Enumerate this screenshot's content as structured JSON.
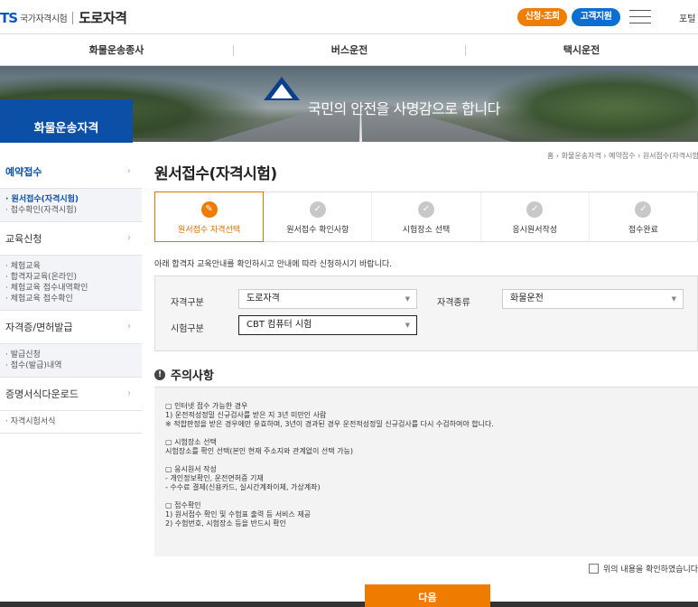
{
  "header": {
    "logo_ts": "TS",
    "logo_org": "국가자격시험",
    "logo_site": "도로자격",
    "apply_label": "신청·조회",
    "support_label": "고객지원",
    "portal_label": "포털"
  },
  "topnav": [
    "화물운송종사",
    "버스운전",
    "택시운전"
  ],
  "banner": {
    "slogan": "국민의 안전을 사명감으로 합니다",
    "side_title": "화물운송자격"
  },
  "sidebar": [
    {
      "label": "예약접수",
      "active": true,
      "subs": [
        {
          "label": "· 원서접수(자격시험)",
          "on": true
        },
        {
          "label": "· 접수확인(자격시험)",
          "on": false
        }
      ]
    },
    {
      "label": "교육신청",
      "active": false,
      "subs": [
        {
          "label": "· 체험교육",
          "on": false
        },
        {
          "label": "· 합격자교육(온라인)",
          "on": false
        },
        {
          "label": "· 체험교육 접수내역확인",
          "on": false
        },
        {
          "label": "· 체험교육 접수확인",
          "on": false
        }
      ]
    },
    {
      "label": "자격증/면허발급",
      "active": false,
      "subs": [
        {
          "label": "· 발급신청",
          "on": false
        },
        {
          "label": "· 접수(발급)내역",
          "on": false
        }
      ]
    },
    {
      "label": "증명서식다운로드",
      "active": false,
      "subs": [
        {
          "label": "· 자격시험서식",
          "on": false
        }
      ]
    }
  ],
  "breadcrumb": "홈 › 화물운송자격 › 예약접수 › 원서접수(자격시험)",
  "page_title": "원서접수(자격시험)",
  "steps": [
    {
      "label": "원서접수 자격선택",
      "current": true
    },
    {
      "label": "원서접수 확인사항",
      "current": false
    },
    {
      "label": "시험장소 선택",
      "current": false
    },
    {
      "label": "응시원서작성",
      "current": false
    },
    {
      "label": "접수완료",
      "current": false
    }
  ],
  "intro": "아래 합격자 교육안내를 확인하시고 안내에 따라 신청하시기 바랍니다.",
  "form": {
    "qual_type_label": "자격구분",
    "qual_type_value": "도로자격",
    "qual_kind_label": "자격종류",
    "qual_kind_value": "화물운전",
    "exam_type_label": "시험구분",
    "exam_type_value": "CBT 컴퓨터 시험",
    "caret": "▼"
  },
  "notice": {
    "title": "주의사항",
    "icon": "!",
    "blocks": [
      [
        "▢ 인터넷 접수 가능한 경우",
        "1) 운전적성정밀 신규검사를 받은 지 3년 미만인 사람",
        "※ 적합판정을 받은 경우에만 유효하며, 3년이 경과된 경우 운전적성정밀 신규검사를 다시 수검하여야 합니다."
      ],
      [
        "▢ 시험장소 선택",
        "시험장소를 확인 선택(본인 현재 주소지와 관계없이 선택 가능)"
      ],
      [
        "▢ 응시원서 작성",
        "- 개인정보확인, 운전면허증 기재",
        "- 수수료 결제(신용카드, 실시간계좌이체, 가상계좌)"
      ],
      [
        "▢ 접수확인",
        "1) 원서접수 확인 및 수험표 출력 등 서비스 제공",
        "2) 수험번호, 시험장소 등을 반드시 확인"
      ]
    ]
  },
  "confirm_label": "위의 내용을 확인하였습니다",
  "next_label": "다음",
  "colors": {
    "accent": "#ef7b00",
    "brand": "#0b4fa7"
  }
}
